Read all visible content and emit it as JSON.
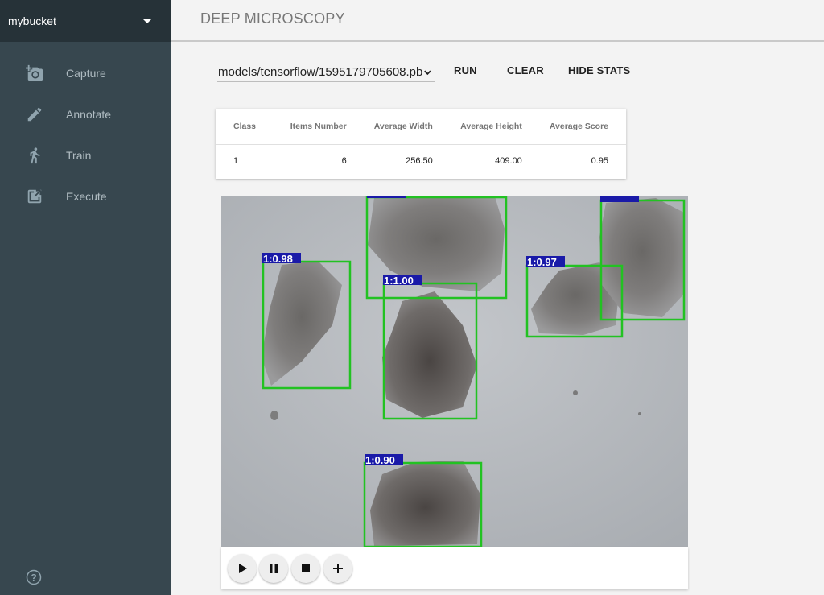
{
  "sidebar": {
    "bucket": "mybucket",
    "items": [
      {
        "label": "Capture",
        "icon": "camera-add-icon"
      },
      {
        "label": "Annotate",
        "icon": "pencil-icon"
      },
      {
        "label": "Train",
        "icon": "running-person-icon"
      },
      {
        "label": "Execute",
        "icon": "execute-icon"
      }
    ],
    "help_icon": "help-icon"
  },
  "header": {
    "title": "DEEP MICROSCOPY"
  },
  "toolbar": {
    "model_value": "models/tensorflow/1595179705608.pb",
    "run_label": "RUN",
    "clear_label": "CLEAR",
    "hide_stats_label": "HIDE STATS"
  },
  "stats": {
    "headers": [
      "Class",
      "Items Number",
      "Average Width",
      "Average Height",
      "Average Score"
    ],
    "rows": [
      [
        "1",
        "6",
        "256.50",
        "409.00",
        "0.95"
      ]
    ]
  },
  "detections": [
    "1:0.98",
    "1:1.00",
    "1:0.97",
    "1:0.90"
  ],
  "colors": {
    "box": "#22c222",
    "label_bg": "#1a1aa8",
    "sidebar": "#37474f",
    "sidebar_top": "#263238"
  },
  "player": {
    "buttons": [
      {
        "icon": "play-icon"
      },
      {
        "icon": "pause-icon"
      },
      {
        "icon": "stop-icon"
      },
      {
        "icon": "plus-icon"
      }
    ]
  }
}
